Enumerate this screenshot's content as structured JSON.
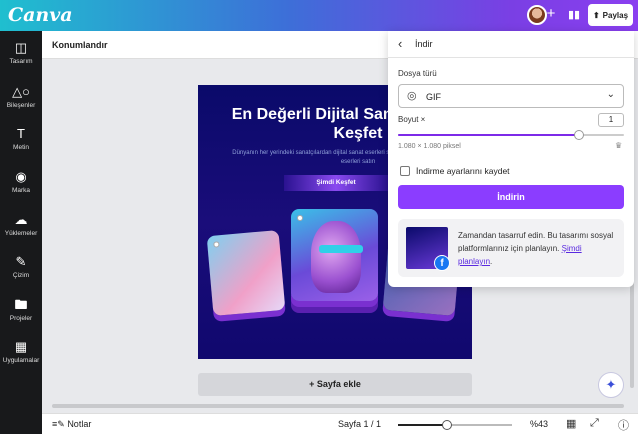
{
  "topbar": {
    "logo": "Canva",
    "share_label": "Paylaş",
    "plus_icon": "plus-icon",
    "stats_icon": "stats-icon"
  },
  "sidebar": {
    "items": [
      {
        "label": "Tasarım",
        "icon": "layout-icon"
      },
      {
        "label": "Bileşenler",
        "icon": "shapes-icon"
      },
      {
        "label": "Metin",
        "icon": "text-icon"
      },
      {
        "label": "Marka",
        "icon": "brand-icon"
      },
      {
        "label": "Yüklemeler",
        "icon": "cloud-upload-icon"
      },
      {
        "label": "Çizim",
        "icon": "pen-icon"
      },
      {
        "label": "Projeler",
        "icon": "folder-icon"
      },
      {
        "label": "Uygulamalar",
        "icon": "apps-icon"
      }
    ]
  },
  "editor": {
    "position_label": "Konumlandır",
    "add_page_label": "+ Sayfa ekle"
  },
  "canvas": {
    "title": "En Değerli Dijital Sanat Eserlerini Keşfet",
    "subtitle": "Dünyanın her yerindeki sanatçılardan dijital sanat eserleri satın alın veya kendi oluşturduğunuz eserleri satın",
    "button_label": "Şimdi Keşfet"
  },
  "footer": {
    "notes_label": "Notlar",
    "pages_label": "Sayfa 1 / 1",
    "zoom_label": "%43",
    "zoom_fraction": 0.43
  },
  "download_panel": {
    "title": "İndir",
    "file_type_label": "Dosya türü",
    "file_type_value": "GIF",
    "size_label": "Boyut ×",
    "size_value": "1",
    "size_fraction": 0.8,
    "pixel_info": "1.080 × 1.080 piksel",
    "save_settings_label": "İndirme ayarlarını kaydet",
    "save_settings_checked": false,
    "download_button": "İndirin",
    "promo_text": "Zamandan tasarruf edin. Bu tasarımı sosyal platformlarınız için planlayın.",
    "promo_link": "Şimdi planlayın",
    "accent_color": "#8b3dff"
  }
}
